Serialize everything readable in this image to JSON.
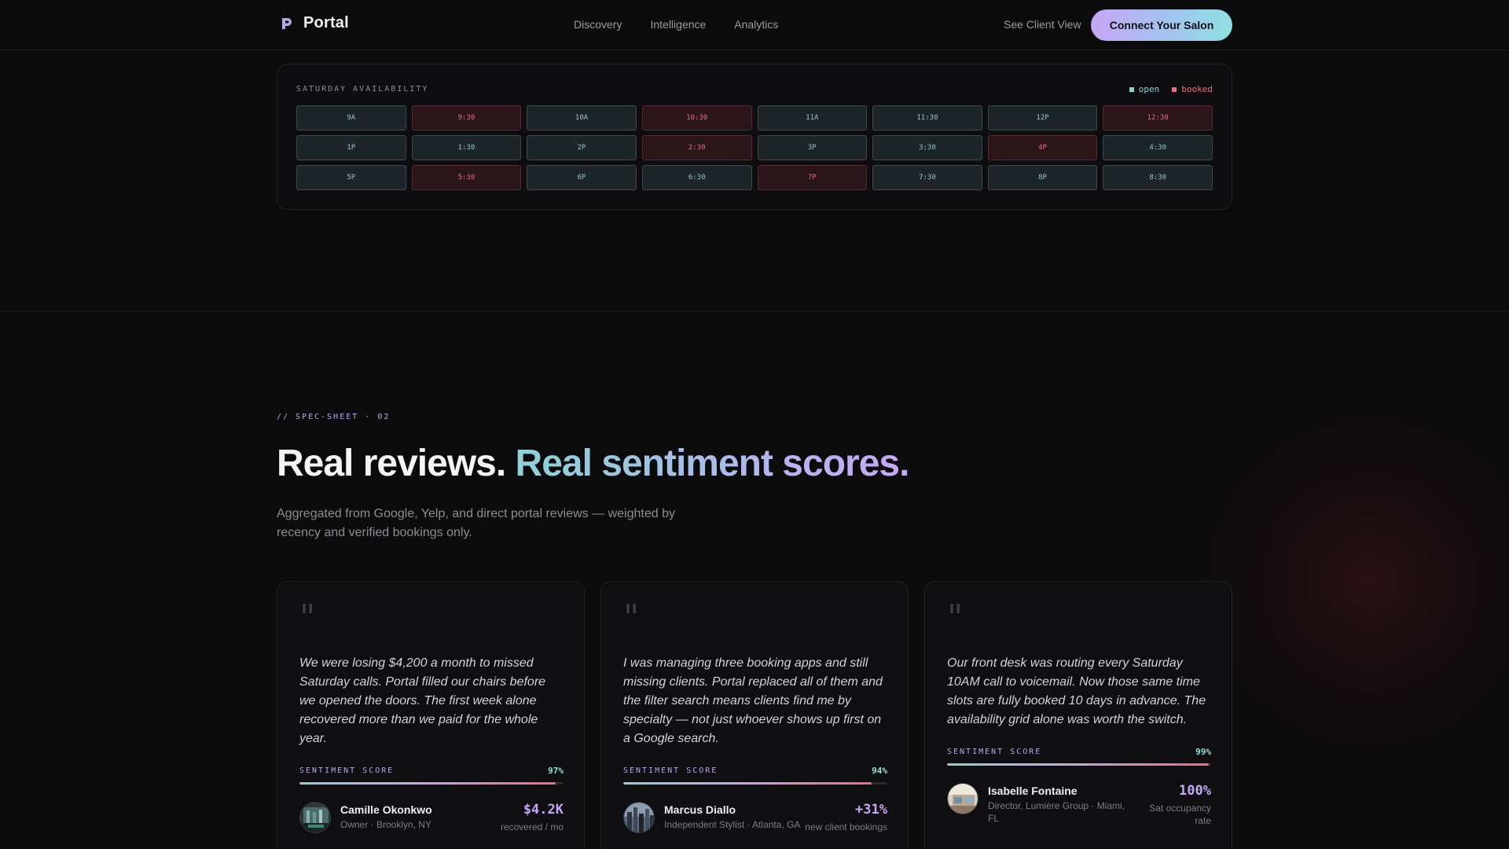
{
  "nav": {
    "brand": "Portal",
    "links": [
      "Discovery",
      "Intelligence",
      "Analytics"
    ],
    "client_view": "See Client View",
    "cta": "Connect Your Salon"
  },
  "availability": {
    "title": "SATURDAY AVAILABILITY",
    "legend": {
      "open": "open",
      "booked": "booked"
    },
    "colors": {
      "open": "#8fd0d6",
      "booked": "#ee6a82"
    },
    "slots": [
      {
        "label": "9A",
        "status": "open"
      },
      {
        "label": "9:30",
        "status": "booked"
      },
      {
        "label": "10A",
        "status": "open"
      },
      {
        "label": "10:30",
        "status": "booked"
      },
      {
        "label": "11A",
        "status": "open"
      },
      {
        "label": "11:30",
        "status": "open"
      },
      {
        "label": "12P",
        "status": "open"
      },
      {
        "label": "12:30",
        "status": "booked"
      },
      {
        "label": "1P",
        "status": "open"
      },
      {
        "label": "1:30",
        "status": "open"
      },
      {
        "label": "2P",
        "status": "open"
      },
      {
        "label": "2:30",
        "status": "booked"
      },
      {
        "label": "3P",
        "status": "open"
      },
      {
        "label": "3:30",
        "status": "open"
      },
      {
        "label": "4P",
        "status": "booked"
      },
      {
        "label": "4:30",
        "status": "open"
      },
      {
        "label": "5P",
        "status": "open"
      },
      {
        "label": "5:30",
        "status": "booked"
      },
      {
        "label": "6P",
        "status": "open"
      },
      {
        "label": "6:30",
        "status": "open"
      },
      {
        "label": "7P",
        "status": "booked"
      },
      {
        "label": "7:30",
        "status": "open"
      },
      {
        "label": "8P",
        "status": "open"
      },
      {
        "label": "8:30",
        "status": "open"
      }
    ]
  },
  "section": {
    "eyebrow": "// SPEC-SHEET · 02",
    "headline_plain": "Real reviews. ",
    "headline_accent": "Real sentiment scores.",
    "subtext": "Aggregated from Google, Yelp, and direct portal reviews — weighted by recency and verified bookings only."
  },
  "reviews": [
    {
      "quote": "We were losing $4,200 a month to missed Saturday calls. Portal filled our chairs before we opened the doors. The first week alone recovered more than we paid for the whole year.",
      "score_label": "SENTIMENT SCORE",
      "score_text": "97%",
      "score": 97,
      "name": "Camille Okonkwo",
      "role": "Owner · Brooklyn, NY",
      "metric_value": "$4.2K",
      "metric_label": "recovered / mo",
      "avatar_icon": "salon-photo-icon"
    },
    {
      "quote": "I was managing three booking apps and still missing clients. Portal replaced all of them and the filter search means clients find me by specialty — not just whoever shows up first on a Google search.",
      "score_label": "SENTIMENT SCORE",
      "score_text": "94%",
      "score": 94,
      "name": "Marcus Diallo",
      "role": "Independent Stylist · Atlanta, GA",
      "metric_value": "+31%",
      "metric_label": "new client bookings",
      "avatar_icon": "city-photo-icon"
    },
    {
      "quote": "Our front desk was routing every Saturday 10AM call to voicemail. Now those same time slots are fully booked 10 days in advance. The availability grid alone was worth the switch.",
      "score_label": "SENTIMENT SCORE",
      "score_text": "99%",
      "score": 99,
      "name": "Isabelle Fontaine",
      "role": "Director, Lumière Group · Miami, FL",
      "metric_value": "100%",
      "metric_label": "Sat occupancy rate",
      "avatar_icon": "interior-photo-icon"
    }
  ]
}
